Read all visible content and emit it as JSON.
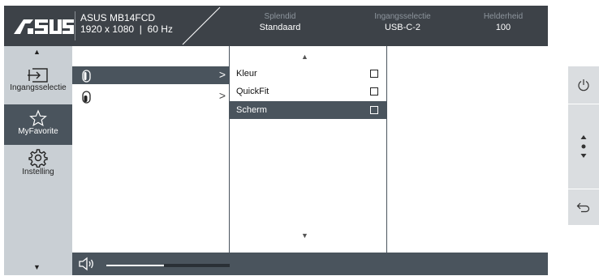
{
  "header": {
    "brand": "ASUS",
    "model": "ASUS MB14FCD",
    "resolution": "1920 x 1080",
    "refresh": "60 Hz",
    "stats": [
      {
        "label": "Splendid",
        "value": "Standaard"
      },
      {
        "label": "Ingangsselectie",
        "value": "USB-C-2"
      },
      {
        "label": "Helderheid",
        "value": "100"
      }
    ]
  },
  "sidebar": {
    "items": [
      {
        "label": "Ingangsselectie",
        "icon": "input-icon"
      },
      {
        "label": "MyFavorite",
        "icon": "star-icon"
      },
      {
        "label": "Instelling",
        "icon": "gear-icon"
      }
    ],
    "active_index": 1
  },
  "column1": {
    "items": [
      {
        "icon": "shortcut-switch-1-icon",
        "selected": true
      },
      {
        "icon": "shortcut-switch-2-icon",
        "selected": false
      }
    ]
  },
  "column2": {
    "items": [
      {
        "label": "Kleur",
        "selected": false
      },
      {
        "label": "QuickFit",
        "selected": false
      },
      {
        "label": "Scherm",
        "selected": true
      }
    ]
  },
  "volume": {
    "level": 0.47
  },
  "buttons": [
    "power-icon",
    "navigate-icon",
    "back-icon"
  ],
  "colors": {
    "header_bg": "#3d4248",
    "sidebar_bg": "#c9cfd4",
    "selected_bg": "#4a545d",
    "stat_label": "#8d959d"
  }
}
